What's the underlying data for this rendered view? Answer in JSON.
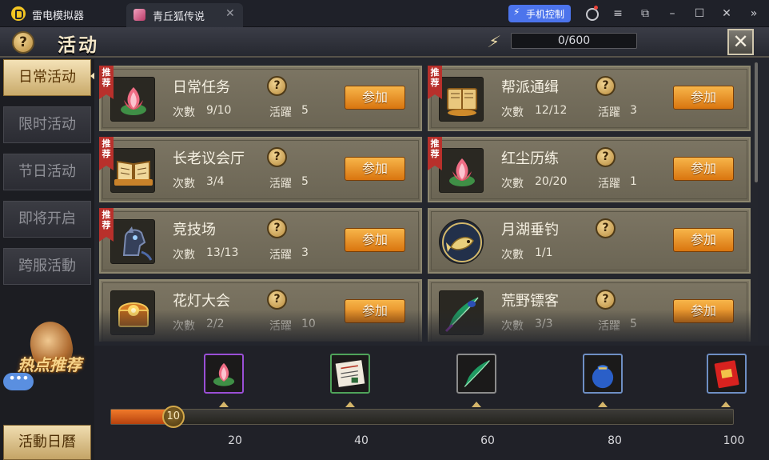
{
  "window": {
    "app_title": "雷电模拟器",
    "tab_title": "青丘狐传说",
    "tab_close": "✕",
    "phone_control": "手机控制",
    "controls": [
      "≡",
      "⧉",
      "–",
      "☐",
      "✕",
      "»"
    ]
  },
  "header": {
    "title": "活动",
    "energy": "0/600"
  },
  "sidebar": {
    "tabs": [
      {
        "label": "日常活动",
        "active": true
      },
      {
        "label": "限时活动",
        "active": false
      },
      {
        "label": "节日活动",
        "active": false
      },
      {
        "label": "即将开启",
        "active": false
      },
      {
        "label": "跨服活動",
        "active": false
      }
    ],
    "hot_label": "热点推荐",
    "calendar_label": "活動日曆"
  },
  "labels": {
    "count": "次數",
    "activity": "活躍",
    "join": "参加",
    "recommend": "推荐"
  },
  "activities": [
    {
      "name": "日常任务",
      "count": "9/10",
      "activity": "5",
      "recommended": true,
      "icon": "lotus-icon"
    },
    {
      "name": "帮派通缉",
      "count": "12/12",
      "activity": "3",
      "recommended": true,
      "icon": "scroll-book-icon"
    },
    {
      "name": "长老议会厅",
      "count": "3/4",
      "activity": "5",
      "recommended": true,
      "icon": "open-book-icon"
    },
    {
      "name": "红尘历练",
      "count": "20/20",
      "activity": "1",
      "recommended": true,
      "icon": "lotus-icon"
    },
    {
      "name": "竞技场",
      "count": "13/13",
      "activity": "3",
      "recommended": true,
      "icon": "horse-helmet-icon"
    },
    {
      "name": "月湖垂钓",
      "count": "1/1",
      "activity": "",
      "recommended": false,
      "icon": "fish-icon"
    },
    {
      "name": "花灯大会",
      "count": "2/2",
      "activity": "10",
      "recommended": false,
      "icon": "treasure-chest-icon"
    },
    {
      "name": "荒野镖客",
      "count": "3/3",
      "activity": "5",
      "recommended": false,
      "icon": "feather-icon"
    }
  ],
  "rewards": {
    "progress": 10,
    "knob_label": "10",
    "max": 100,
    "milestones": [
      20,
      40,
      60,
      80,
      100
    ],
    "milestone_labels": [
      "20",
      "40",
      "60",
      "80",
      "100"
    ],
    "items": [
      "lotus-icon",
      "letter-icon",
      "feather-icon",
      "pouch-icon",
      "red-envelope-icon"
    ]
  },
  "colors": {
    "join_button": "#e8901e",
    "ribbon": "#b8302b",
    "active_tab": "#f0ddb0",
    "progress_fill": "#e46a1e"
  }
}
